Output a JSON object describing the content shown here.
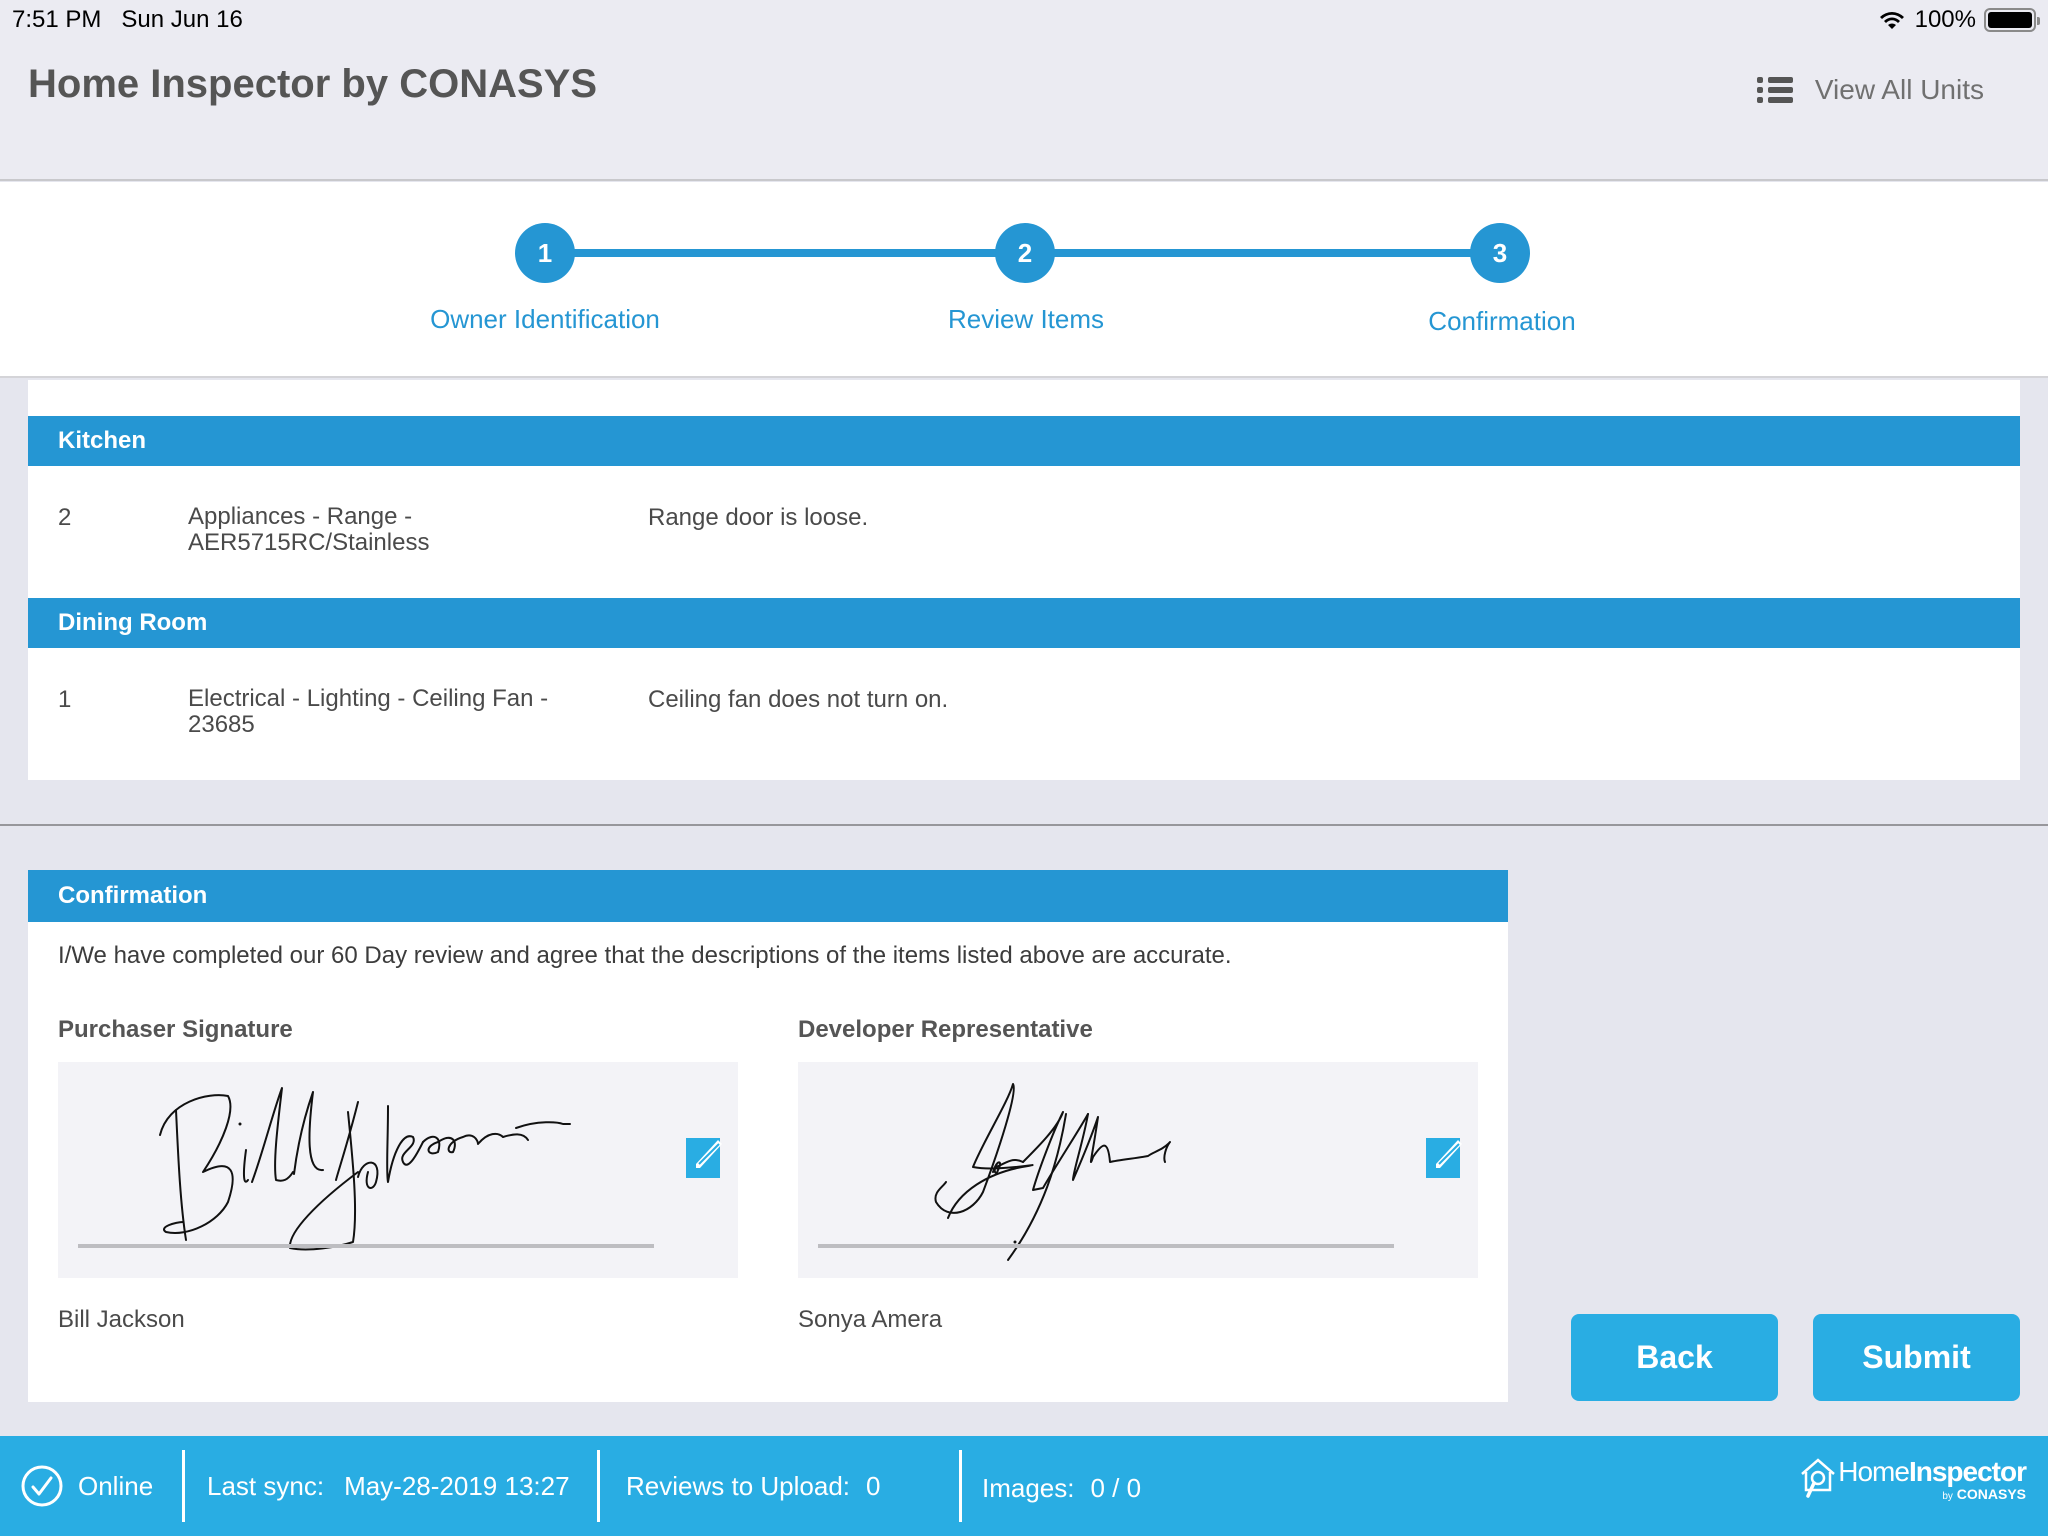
{
  "status_bar": {
    "time": "7:51 PM",
    "date": "Sun Jun 16",
    "battery": "100%",
    "wifi_icon": "wifi-icon",
    "battery_icon": "battery-icon"
  },
  "header": {
    "title": "Home Inspector by CONASYS",
    "view_all_units": "View All Units",
    "view_all_icon": "list-icon"
  },
  "stepper": {
    "current_step": 3,
    "steps": [
      {
        "number": "1",
        "label": "Owner Identification"
      },
      {
        "number": "2",
        "label": "Review Items"
      },
      {
        "number": "3",
        "label": "Confirmation"
      }
    ]
  },
  "review_items": {
    "rooms": [
      {
        "name": "Kitchen",
        "items": [
          {
            "number": "2",
            "item": "Appliances - Range - AER5715RC/Stainless",
            "description": "Range door is loose."
          }
        ]
      },
      {
        "name": "Dining Room",
        "items": [
          {
            "number": "1",
            "item": "Electrical - Lighting - Ceiling Fan - 23685",
            "description": "Ceiling fan does not turn on."
          }
        ]
      }
    ]
  },
  "confirmation": {
    "title": "Confirmation",
    "statement": "I/We have completed our 60 Day review and agree that the descriptions of the items listed above are accurate.",
    "purchaser": {
      "label": "Purchaser Signature",
      "name": "Bill Jackson"
    },
    "developer": {
      "label": "Developer Representative",
      "name": "Sonya Amera"
    }
  },
  "actions": {
    "back": "Back",
    "submit": "Submit"
  },
  "footer": {
    "status": "Online",
    "last_sync_label": "Last sync:",
    "last_sync_value": "May-28-2019 13:27",
    "reviews_label": "Reviews to Upload:",
    "reviews_value": "0",
    "images_label": "Images:",
    "images_value": "0 / 0",
    "logo_home": "Home",
    "logo_inspector": "Inspector",
    "logo_by": "by",
    "logo_conasys": "CONASYS"
  },
  "colors": {
    "accent": "#2596d3",
    "button": "#29ade3",
    "footer": "#29ade3",
    "background": "#e5e6ee"
  }
}
